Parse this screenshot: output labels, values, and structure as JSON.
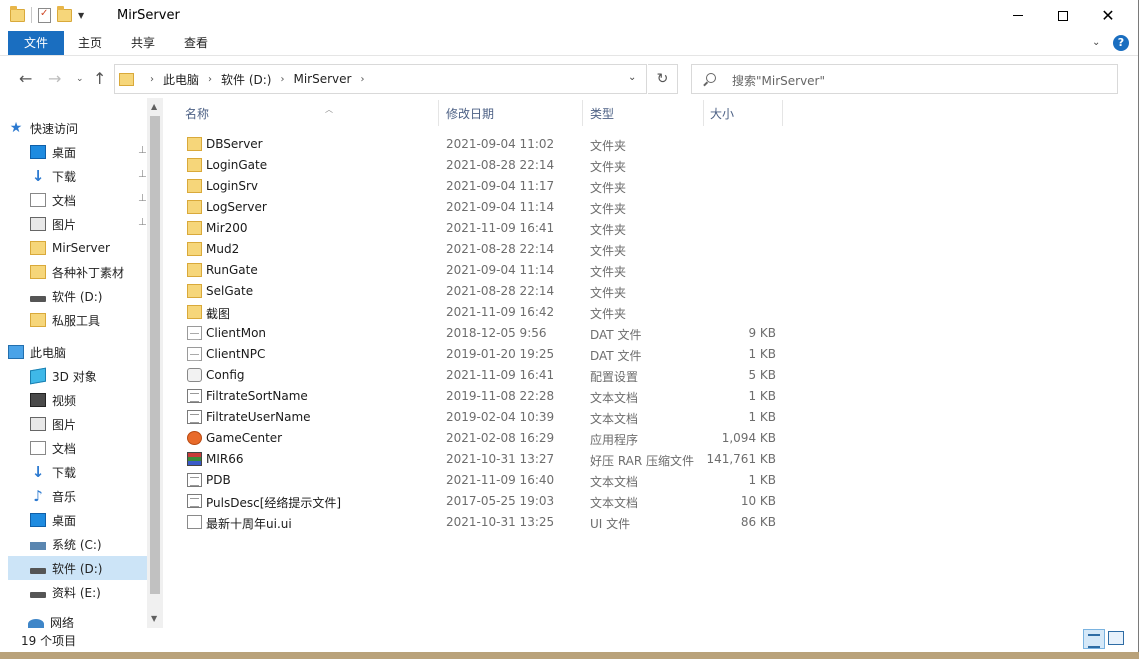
{
  "window": {
    "title": "MirServer"
  },
  "ribbon": {
    "tabs": [
      "文件",
      "主页",
      "共享",
      "查看"
    ],
    "help": "?"
  },
  "address": {
    "crumbs": [
      "此电脑",
      "软件 (D:)",
      "MirServer"
    ]
  },
  "search": {
    "placeholder": "搜索\"MirServer\""
  },
  "nav": {
    "items": [
      {
        "label": "快速访问",
        "icon": "star-icon"
      },
      {
        "label": "桌面",
        "icon": "desktop-icon",
        "pinned": true
      },
      {
        "label": "下载",
        "icon": "download-icon",
        "pinned": true
      },
      {
        "label": "文档",
        "icon": "document-icon",
        "pinned": true
      },
      {
        "label": "图片",
        "icon": "picture-icon",
        "pinned": true
      },
      {
        "label": "MirServer",
        "icon": "folder-icon"
      },
      {
        "label": "各种补丁素材",
        "icon": "folder-icon"
      },
      {
        "label": "软件 (D:)",
        "icon": "drive-icon"
      },
      {
        "label": "私服工具",
        "icon": "folder-icon"
      },
      {
        "label": "此电脑",
        "icon": "pc-icon"
      },
      {
        "label": "3D 对象",
        "icon": "3d-objects-icon"
      },
      {
        "label": "视频",
        "icon": "video-icon"
      },
      {
        "label": "图片",
        "icon": "picture-icon"
      },
      {
        "label": "文档",
        "icon": "document-icon"
      },
      {
        "label": "下载",
        "icon": "download-icon"
      },
      {
        "label": "音乐",
        "icon": "music-icon"
      },
      {
        "label": "桌面",
        "icon": "desktop-icon"
      },
      {
        "label": "系统 (C:)",
        "icon": "system-drive-icon"
      },
      {
        "label": "软件 (D:)",
        "icon": "drive-icon",
        "selected": true
      },
      {
        "label": "资料 (E:)",
        "icon": "drive-icon"
      },
      {
        "label": "网络",
        "icon": "network-icon"
      }
    ]
  },
  "columns": {
    "name": "名称",
    "date": "修改日期",
    "type": "类型",
    "size": "大小"
  },
  "files": [
    {
      "name": "DBServer",
      "date": "2021-09-04 11:02",
      "type": "文件夹",
      "size": "",
      "icon": "folder"
    },
    {
      "name": "LoginGate",
      "date": "2021-08-28 22:14",
      "type": "文件夹",
      "size": "",
      "icon": "folder"
    },
    {
      "name": "LoginSrv",
      "date": "2021-09-04 11:17",
      "type": "文件夹",
      "size": "",
      "icon": "folder"
    },
    {
      "name": "LogServer",
      "date": "2021-09-04 11:14",
      "type": "文件夹",
      "size": "",
      "icon": "folder"
    },
    {
      "name": "Mir200",
      "date": "2021-11-09 16:41",
      "type": "文件夹",
      "size": "",
      "icon": "folder"
    },
    {
      "name": "Mud2",
      "date": "2021-08-28 22:14",
      "type": "文件夹",
      "size": "",
      "icon": "folder"
    },
    {
      "name": "RunGate",
      "date": "2021-09-04 11:14",
      "type": "文件夹",
      "size": "",
      "icon": "folder"
    },
    {
      "name": "SelGate",
      "date": "2021-08-28 22:14",
      "type": "文件夹",
      "size": "",
      "icon": "folder"
    },
    {
      "name": "截图",
      "date": "2021-11-09 16:42",
      "type": "文件夹",
      "size": "",
      "icon": "folder"
    },
    {
      "name": "ClientMon",
      "date": "2018-12-05 9:56",
      "type": "DAT 文件",
      "size": "9 KB",
      "icon": "dat"
    },
    {
      "name": "ClientNPC",
      "date": "2019-01-20 19:25",
      "type": "DAT 文件",
      "size": "1 KB",
      "icon": "dat"
    },
    {
      "name": "Config",
      "date": "2021-11-09 16:41",
      "type": "配置设置",
      "size": "5 KB",
      "icon": "config"
    },
    {
      "name": "FiltrateSortName",
      "date": "2019-11-08 22:28",
      "type": "文本文档",
      "size": "1 KB",
      "icon": "txt"
    },
    {
      "name": "FiltrateUserName",
      "date": "2019-02-04 10:39",
      "type": "文本文档",
      "size": "1 KB",
      "icon": "txt"
    },
    {
      "name": "GameCenter",
      "date": "2021-02-08 16:29",
      "type": "应用程序",
      "size": "1,094 KB",
      "icon": "exe"
    },
    {
      "name": "MIR66",
      "date": "2021-10-31 13:27",
      "type": "好压 RAR 压缩文件",
      "size": "141,761 KB",
      "icon": "rar"
    },
    {
      "name": "PDB",
      "date": "2021-11-09 16:40",
      "type": "文本文档",
      "size": "1 KB",
      "icon": "txt"
    },
    {
      "name": "PulsDesc[经络提示文件]",
      "date": "2017-05-25 19:03",
      "type": "文本文档",
      "size": "10 KB",
      "icon": "txt"
    },
    {
      "name": "最新十周年ui.ui",
      "date": "2021-10-31 13:25",
      "type": "UI 文件",
      "size": "86 KB",
      "icon": "ui"
    }
  ],
  "status": {
    "count": "19 个项目"
  }
}
